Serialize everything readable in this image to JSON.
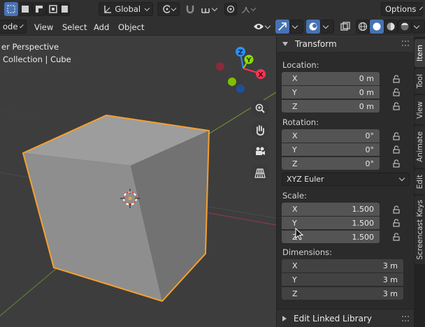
{
  "header": {
    "transform_orientation": "Global",
    "options_label": "Options"
  },
  "menubar": {
    "mode_fragment": "ode",
    "items": [
      "View",
      "Select",
      "Add",
      "Object"
    ]
  },
  "viewport": {
    "view_name": "er Perspective",
    "collection_path": "Collection | Cube",
    "gizmo_axes": [
      "Z",
      "Y",
      "X"
    ]
  },
  "sidebar": {
    "panel_title": "Transform",
    "location": {
      "label": "Location:",
      "fields": [
        {
          "axis": "X",
          "value": "0 m"
        },
        {
          "axis": "Y",
          "value": "0 m"
        },
        {
          "axis": "Z",
          "value": "0 m"
        }
      ]
    },
    "rotation": {
      "label": "Rotation:",
      "fields": [
        {
          "axis": "X",
          "value": "0°"
        },
        {
          "axis": "Y",
          "value": "0°"
        },
        {
          "axis": "Z",
          "value": "0°"
        }
      ],
      "mode": "XYZ Euler"
    },
    "scale": {
      "label": "Scale:",
      "fields": [
        {
          "axis": "X",
          "value": "1.500"
        },
        {
          "axis": "Y",
          "value": "1.500"
        },
        {
          "axis": "Z",
          "value": "1.500"
        }
      ]
    },
    "dimensions": {
      "label": "Dimensions:",
      "fields": [
        {
          "axis": "X",
          "value": "3 m"
        },
        {
          "axis": "Y",
          "value": "3 m"
        },
        {
          "axis": "Z",
          "value": "3 m"
        }
      ]
    },
    "footer_panel": "Edit Linked Library"
  },
  "tabs": [
    "Item",
    "Tool",
    "View",
    "Animate",
    "Edit",
    "Screencast Keys"
  ],
  "colors": {
    "accent": "#4772b3",
    "selection_outline": "#f5a030",
    "axis_x": "#ff3352",
    "axis_y": "#8bdc00",
    "axis_z": "#2890ff"
  }
}
